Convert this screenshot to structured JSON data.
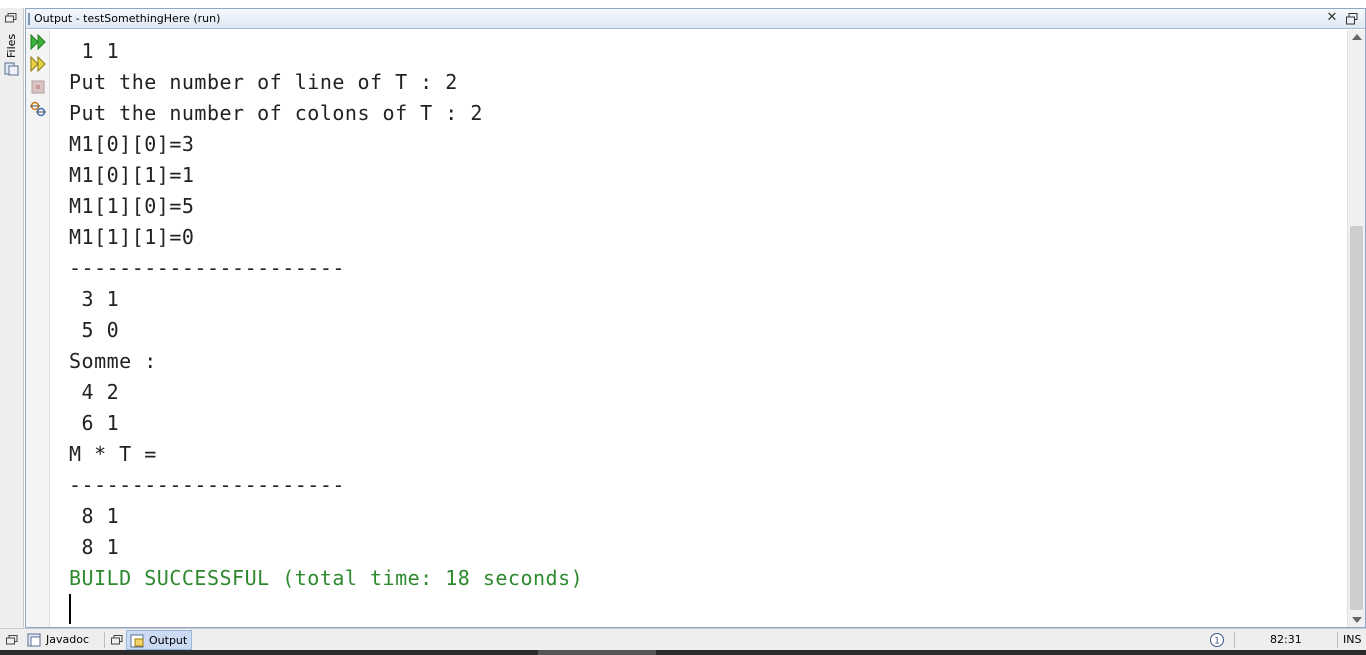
{
  "window": {
    "title": "Output - testSomethingHere (run)"
  },
  "sidebar": {
    "files_tab_label": "Files"
  },
  "toolbar": {
    "icons": [
      "rerun-icon",
      "rerun-with-options-icon",
      "stop-icon",
      "settings-icon"
    ]
  },
  "console": {
    "lines": [
      " 1 1",
      "Put the number of line of T : 2",
      "Put the number of colons of T : 2",
      "M1[0][0]=3",
      "M1[0][1]=1",
      "M1[1][0]=5",
      "M1[1][1]=0",
      "----------------------",
      " 3 1",
      " 5 0",
      "Somme :",
      " 4 2",
      " 6 1",
      "M * T =",
      "----------------------",
      " 8 1",
      " 8 1",
      "BUILD SUCCESSFUL (total time: 18 seconds)"
    ]
  },
  "status_bar": {
    "tabs": [
      {
        "label": "Javadoc",
        "active": false
      },
      {
        "label": "Output",
        "active": true
      }
    ],
    "caret_position": "82:31",
    "insert_mode": "INS"
  },
  "colors": {
    "success_text": "#2f8a2f",
    "active_tab": "#c9daf2",
    "title_bar": "#dfe8f4"
  }
}
